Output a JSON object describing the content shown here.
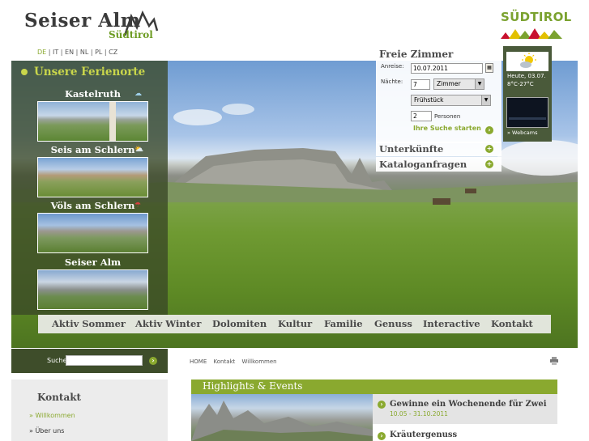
{
  "brand": {
    "name": "Seiser Alm",
    "sub": "Südtirol",
    "region_logo": "SÜDTIROL"
  },
  "languages": [
    "DE",
    "IT",
    "EN",
    "NL",
    "PL",
    "CZ"
  ],
  "active_language": "DE",
  "sidebar": {
    "title": "Unsere Ferienorte",
    "places": [
      {
        "name": "Kastelruth",
        "icon": "cloud-icon"
      },
      {
        "name": "Seis am Schlern",
        "icon": "sun-cloud-icon"
      },
      {
        "name": "Völs am Schlern",
        "icon": "rain-cloud-icon"
      },
      {
        "name": "Seiser Alm",
        "icon": ""
      }
    ]
  },
  "booking": {
    "title": "Freie Zimmer",
    "arrival_label": "Anreise:",
    "arrival_value": "10.07.2011",
    "nights_label": "Nächte:",
    "nights_value": "7",
    "room_type": "Zimmer",
    "board": "Frühstück",
    "persons_value": "2",
    "persons_label": "Personen",
    "search_label": "Ihre Suche starten"
  },
  "accordions": [
    "Unterkünfte",
    "Kataloganfragen"
  ],
  "weather": {
    "today": "Heute, 03.07.",
    "temp": "8°C-27°C",
    "webcam_label": "» Webcams"
  },
  "nav": [
    "Aktiv Sommer",
    "Aktiv Winter",
    "Dolomiten",
    "Kultur",
    "Familie",
    "Genuss",
    "Interactive",
    "Kontakt"
  ],
  "search": {
    "label": "Suche",
    "value": ""
  },
  "breadcrumb": [
    "HOME",
    "Kontakt",
    "Willkommen"
  ],
  "kontakt": {
    "title": "Kontakt",
    "items": [
      "» Willkommen",
      "» Über uns"
    ]
  },
  "highlights": {
    "title": "Highlights & Events",
    "events": [
      {
        "title": "Gewinne ein Wochenende für Zwei",
        "date": "10.05 - 31.10.2011"
      },
      {
        "title": "Kräutergenuss",
        "date": ""
      }
    ]
  },
  "colors": {
    "accent": "#8aa92f",
    "sidebar_bg": "#3a4826",
    "dark_text": "#494949"
  }
}
